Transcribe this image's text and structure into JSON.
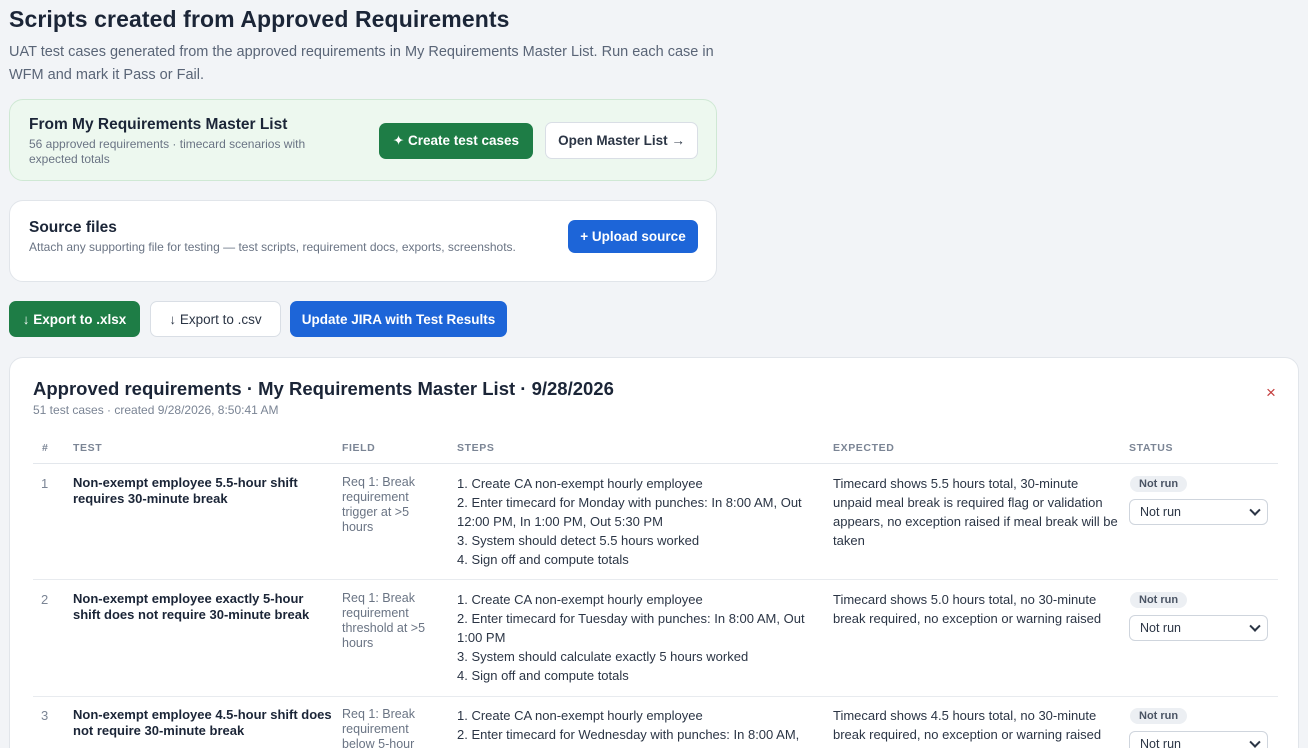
{
  "page": {
    "title": "Scripts created from Approved Requirements",
    "description": "UAT test cases generated from the approved requirements in My Requirements Master List. Run each case in WFM and mark it Pass or Fail."
  },
  "master_list_card": {
    "title": "From My Requirements Master List",
    "subtitle": "56 approved requirements · timecard scenarios with expected totals",
    "create_button": "✦ Create test cases",
    "open_button": "Open Master List →"
  },
  "source_card": {
    "title": "Source files",
    "subtitle": "Attach any supporting file for testing — test scripts, requirement docs, exports, screenshots.",
    "upload_button": "+ Upload source"
  },
  "toolbar": {
    "export_xlsx": "↓ Export to .xlsx",
    "export_csv": "↓ Export to .csv",
    "update_jira": "Update JIRA with Test Results"
  },
  "results": {
    "title": "Approved requirements · My Requirements Master List · 9/28/2026",
    "subtitle": "51 test cases · created 9/28/2026, 8:50:41 AM",
    "close": "×",
    "columns": [
      "#",
      "TEST",
      "FIELD",
      "STEPS",
      "EXPECTED",
      "STATUS"
    ],
    "rows": [
      {
        "num": "1",
        "test": "Non-exempt employee 5.5-hour shift requires 30-minute break",
        "field": "Req 1: Break requirement trigger at >5 hours",
        "steps": [
          "1. Create CA non-exempt hourly employee",
          "2. Enter timecard for Monday with punches: In 8:00 AM, Out 12:00 PM, In 1:00 PM, Out 5:30 PM",
          "3. System should detect 5.5 hours worked",
          "4. Sign off and compute totals"
        ],
        "expected": "Timecard shows 5.5 hours total, 30-minute unpaid meal break is required flag or validation appears, no exception raised if meal break will be taken",
        "badge": "Not run",
        "select": "Not run"
      },
      {
        "num": "2",
        "test": "Non-exempt employee exactly 5-hour shift does not require 30-minute break",
        "field": "Req 1: Break requirement threshold at >5 hours",
        "steps": [
          "1. Create CA non-exempt hourly employee",
          "2. Enter timecard for Tuesday with punches: In 8:00 AM, Out 1:00 PM",
          "3. System should calculate exactly 5 hours worked",
          "4. Sign off and compute totals"
        ],
        "expected": "Timecard shows 5.0 hours total, no 30-minute break required, no exception or warning raised",
        "badge": "Not run",
        "select": "Not run"
      },
      {
        "num": "3",
        "test": "Non-exempt employee 4.5-hour shift does not require 30-minute break",
        "field": "Req 1: Break requirement below 5-hour",
        "steps": [
          "1. Create CA non-exempt hourly employee",
          "2. Enter timecard for Wednesday with punches: In 8:00 AM,"
        ],
        "expected": "Timecard shows 4.5 hours total, no 30-minute break required, no exception or warning raised",
        "badge": "Not run",
        "select": "Not run"
      }
    ]
  },
  "colors": {
    "green": "#1e7d46",
    "blue": "#1d65d8",
    "close": "#c43d3d"
  }
}
